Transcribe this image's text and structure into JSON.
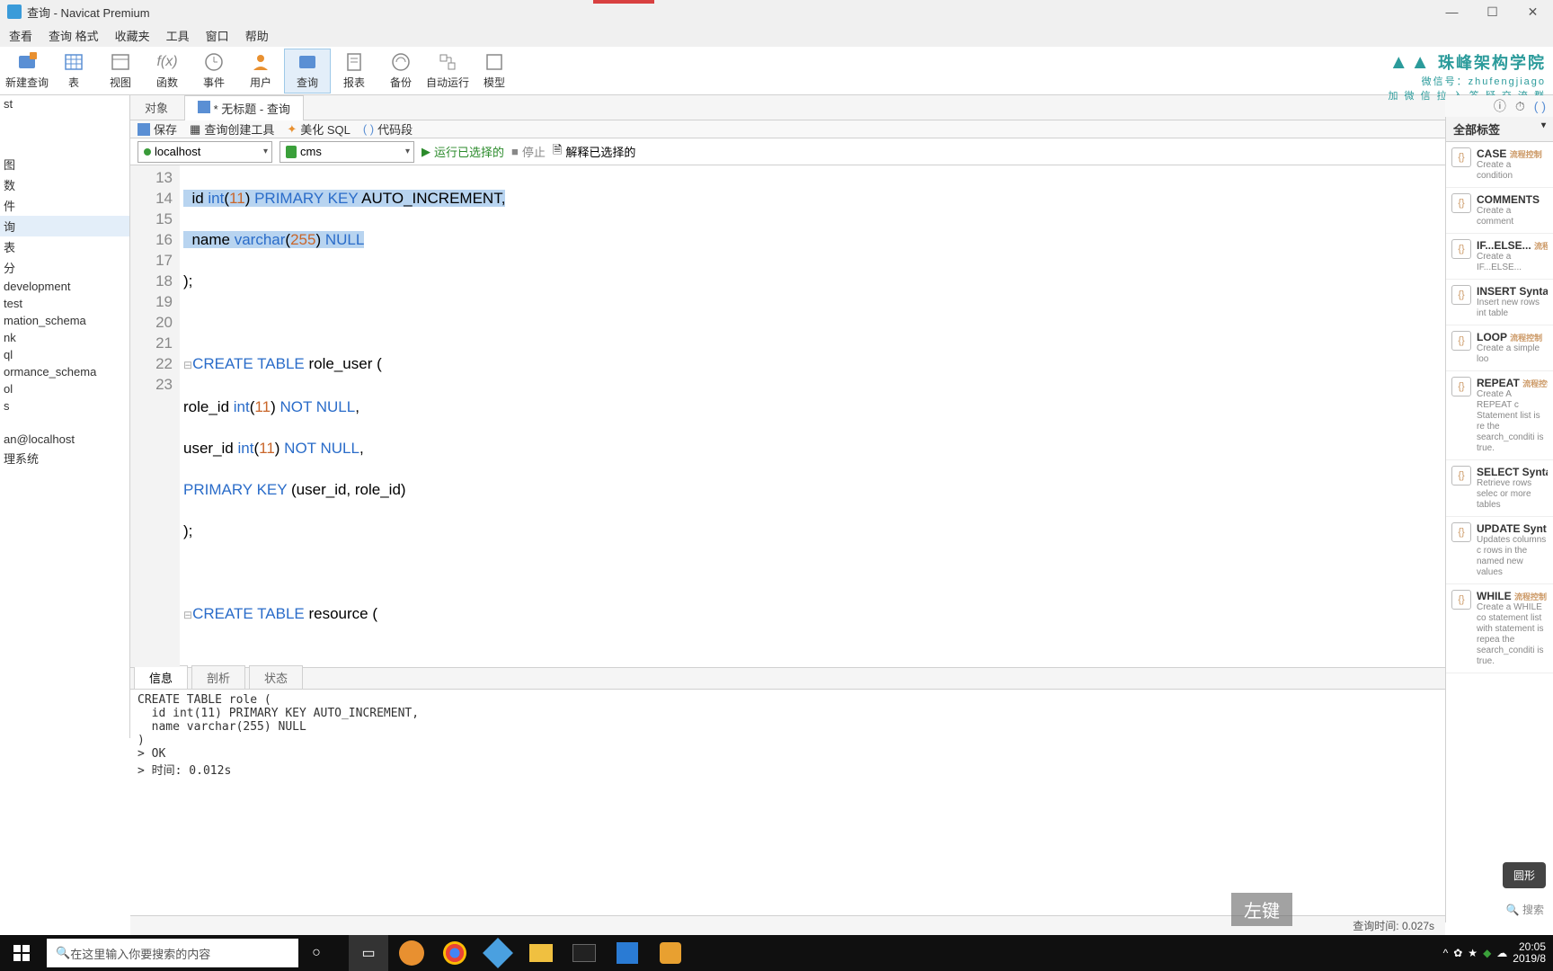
{
  "window": {
    "title": "查询 - Navicat Premium"
  },
  "menu": [
    "查看",
    "查询 格式",
    "收藏夹",
    "工具",
    "窗口",
    "帮助"
  ],
  "toolbar": [
    {
      "label": "新建查询"
    },
    {
      "label": "表"
    },
    {
      "label": "视图"
    },
    {
      "label": "函数"
    },
    {
      "label": "事件"
    },
    {
      "label": "用户"
    },
    {
      "label": "查询"
    },
    {
      "label": "报表"
    },
    {
      "label": "备份"
    },
    {
      "label": "自动运行"
    },
    {
      "label": "模型"
    }
  ],
  "brand": {
    "name": "珠峰架构学院",
    "wx": "微信号：zhufengjiago",
    "sub": "加 微 信 拉 入 答 疑 交 流 群"
  },
  "left_items": [
    "st",
    "图",
    "数",
    "件",
    "询",
    "表",
    "分",
    "development",
    "test",
    "mation_schema",
    "nk",
    "ql",
    "ormance_schema",
    "ol",
    "s",
    "an@localhost",
    "理系统"
  ],
  "tabs": {
    "obj": "对象",
    "query": "* 无标题 - 查询"
  },
  "qbar": {
    "save": "保存",
    "builder": "查询创建工具",
    "beautify": "美化 SQL",
    "snippet": "代码段"
  },
  "conn": {
    "host": "localhost",
    "db": "cms",
    "run": "运行已选择的",
    "stop": "停止",
    "explain": "解释已选择的"
  },
  "lines": [
    "13",
    "14",
    "15",
    "16",
    "17",
    "18",
    "19",
    "20",
    "21",
    "22",
    "23"
  ],
  "code": {
    "l13_a": "  id ",
    "l13_b": "int",
    "l13_c": "(",
    "l13_d": "11",
    "l13_e": ") ",
    "l13_f": "PRIMARY KEY",
    "l13_g": " AUTO_INCREMENT,",
    "l14_a": "  name ",
    "l14_b": "varchar",
    "l14_c": "(",
    "l14_d": "255",
    "l14_e": ") ",
    "l14_f": "NULL",
    "l15": ");",
    "l17_a": "CREATE TABLE",
    "l17_b": " role_user (",
    "l18_a": "role_id ",
    "l18_b": "int",
    "l18_c": "(",
    "l18_d": "11",
    "l18_e": ") ",
    "l18_f": "NOT NULL",
    "l18_g": ",",
    "l19_a": "user_id ",
    "l19_b": "int",
    "l19_c": "(",
    "l19_d": "11",
    "l19_e": ") ",
    "l19_f": "NOT NULL",
    "l19_g": ",",
    "l20_a": "PRIMARY KEY",
    "l20_b": " (user_id, role_id)",
    "l21": ");",
    "l23_a": "CREATE TABLE",
    "l23_b": " resource ("
  },
  "btabs": {
    "info": "信息",
    "profile": "剖析",
    "status": "状态"
  },
  "output": "CREATE TABLE role (\n  id int(11) PRIMARY KEY AUTO_INCREMENT,\n  name varchar(255) NULL\n)\n> OK\n> 时间: 0.012s",
  "snip_header": "全部标签",
  "snippets": [
    {
      "name": "CASE",
      "tag": "流程控制",
      "desc": "Create a condition"
    },
    {
      "name": "COMMENTS",
      "tag": "",
      "desc": "Create a comment"
    },
    {
      "name": "IF...ELSE...",
      "tag": "流程",
      "desc": "Create a IF...ELSE..."
    },
    {
      "name": "INSERT Synta",
      "tag": "",
      "desc": "Insert new rows int table"
    },
    {
      "name": "LOOP",
      "tag": "流程控制",
      "desc": "Create a simple loo"
    },
    {
      "name": "REPEAT",
      "tag": "流程控制",
      "desc": "Create A REPEAT c Statement list is re the search_conditi is true."
    },
    {
      "name": "SELECT Synta",
      "tag": "",
      "desc": "Retrieve rows selec or more tables"
    },
    {
      "name": "UPDATE Synt",
      "tag": "",
      "desc": "Updates columns c rows in the named new values"
    },
    {
      "name": "WHILE",
      "tag": "流程控制",
      "desc": "Create a WHILE co statement list with statement is repea the search_conditi is true."
    }
  ],
  "search_ph": "搜索",
  "round_btn": "圆形",
  "status": "查询时间: 0.027s",
  "overlay": "左键",
  "taskbar": {
    "search": "在这里输入你要搜索的内容",
    "time": "20:05",
    "date": "2019/8"
  }
}
